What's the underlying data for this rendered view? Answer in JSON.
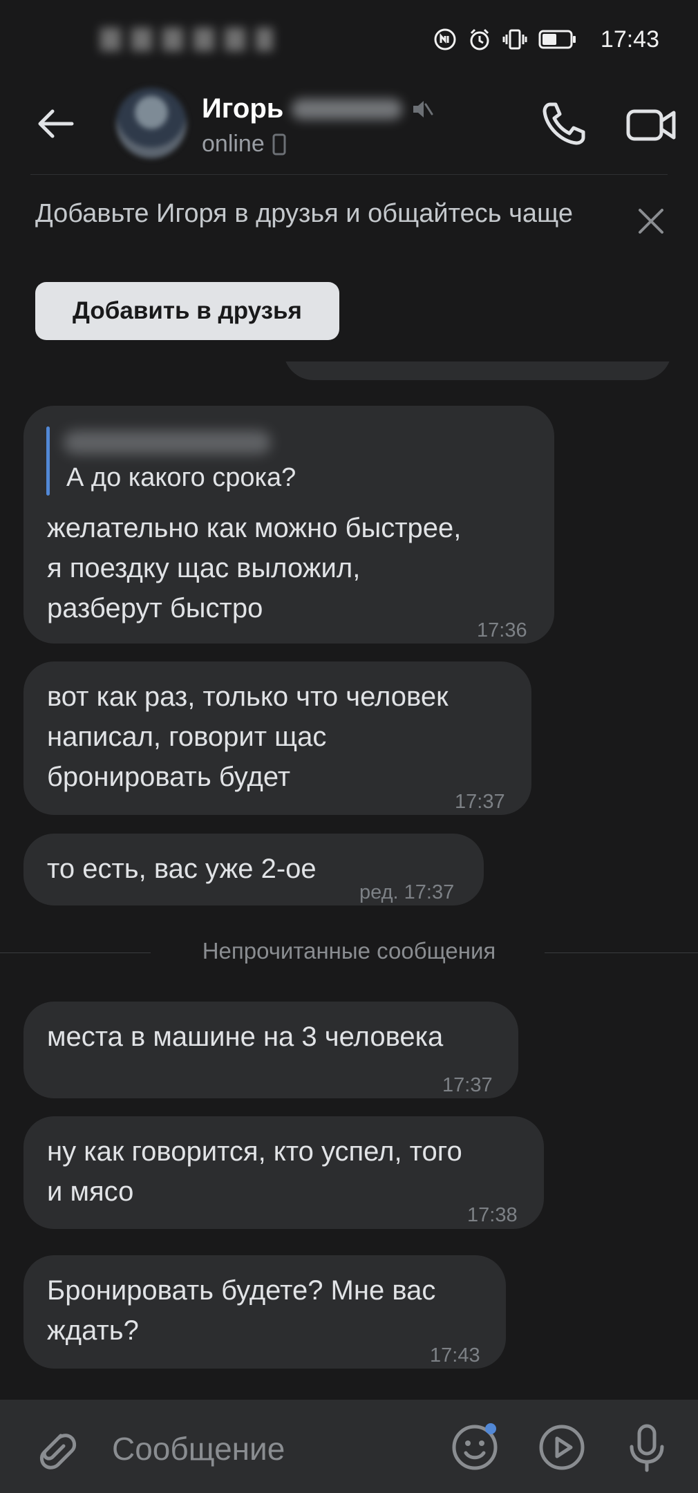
{
  "status_bar": {
    "time": "17:43",
    "icons": [
      "nfc-icon",
      "alarm-icon",
      "vibrate-icon",
      "battery-icon"
    ]
  },
  "header": {
    "name": "Игорь",
    "status": "online",
    "icons": [
      "back-arrow-icon",
      "phone-icon",
      "video-camera-icon",
      "mute-icon",
      "mobile-device-icon"
    ]
  },
  "banner": {
    "text": "Добавьте Игоря в друзья и общайтесь чаще",
    "button_label": "Добавить в друзья"
  },
  "messages": [
    {
      "reply_to": "А до какого срока?",
      "lines": [
        "желательно как можно быстрее,",
        "я поездку щас выложил,",
        "разберут быстро"
      ],
      "time": "17:36"
    },
    {
      "lines": [
        "вот как раз, только что человек",
        "написал, говорит щас",
        "бронировать будет"
      ],
      "time": "17:37"
    },
    {
      "lines": [
        "то есть, вас уже 2-ое"
      ],
      "time": "ред. 17:37"
    },
    {
      "lines": [
        "места в машине на 3 человека"
      ],
      "time": "17:37"
    },
    {
      "lines": [
        "ну как говорится, кто успел, того",
        "и мясо"
      ],
      "time": "17:38"
    },
    {
      "lines": [
        "Бронировать будете? Мне вас",
        "ждать?"
      ],
      "time": "17:43"
    }
  ],
  "unread_divider": "Непрочитанные сообщения",
  "composer": {
    "placeholder": "Сообщение"
  },
  "colors": {
    "background": "#19191a",
    "bubble": "#2c2d2f",
    "accent": "#5288d6",
    "button": "#e1e3e6"
  }
}
